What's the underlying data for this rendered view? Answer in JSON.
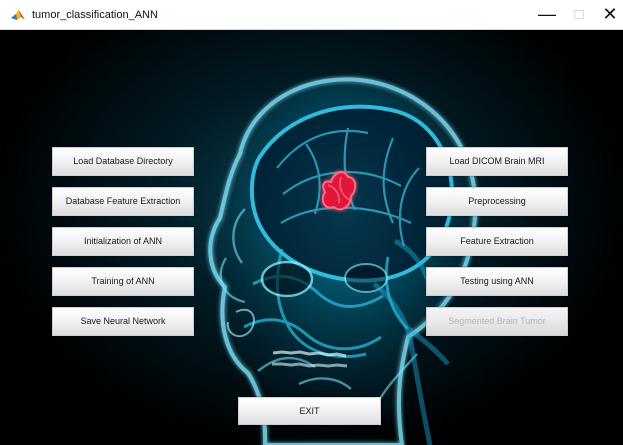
{
  "window": {
    "title": "tumor_classification_ANN",
    "controls": {
      "minimize": "—",
      "maximize": "□",
      "close": "✕"
    }
  },
  "buttons": {
    "left": [
      "Load Database Directory",
      "Database Feature Extraction",
      "Initialization of ANN",
      "Training of ANN",
      "Save Neural Network"
    ],
    "right": [
      "Load DICOM Brain MRI",
      "Preprocessing",
      "Feature Extraction",
      "Testing using ANN",
      "Segmented Brain Tumor"
    ],
    "exit": "EXIT"
  },
  "icons": {
    "app": "matlab-icon",
    "background": "brain-skull-xray-image",
    "tumor": "tumor-highlight"
  },
  "colors": {
    "background": "#000000",
    "glow": "#0aa7d0",
    "tumor": "#e0173b",
    "button_text": "#1a1a1a",
    "disabled_text": "#b4b4b4"
  },
  "states": {
    "segmented_brain_tumor_enabled": false
  }
}
